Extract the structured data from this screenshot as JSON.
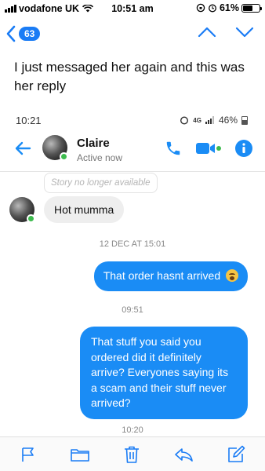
{
  "status_bar": {
    "carrier": "vodafone UK",
    "time": "10:51 am",
    "battery": "61%",
    "battery_level": 0.61
  },
  "mail_nav": {
    "unread_count": "63",
    "icons": [
      "back-chevron-icon",
      "up-chevron-icon",
      "down-chevron-icon"
    ]
  },
  "post_text": "I just messaged her again and this was her reply",
  "screenshot": {
    "status": {
      "time": "10:21",
      "network": "4G",
      "battery": "46%"
    },
    "header": {
      "name": "Claire",
      "subtitle": "Active now"
    },
    "story_notice": "Story no longer available",
    "messages": [
      {
        "direction": "in",
        "text": "Hot mumma"
      },
      {
        "timestamp": "12 DEC AT 15:01"
      },
      {
        "direction": "out",
        "text": "That order hasnt arrived",
        "emoji": "fearful-face"
      },
      {
        "timestamp": "09:51"
      },
      {
        "direction": "out",
        "text": "That stuff you said you ordered did it definitely arrive? Everyones saying its a scam and their stuff never arrived?"
      },
      {
        "timestamp": "10:20"
      }
    ]
  },
  "toolbar": {
    "icons": [
      "flag-icon",
      "folder-icon",
      "trash-icon",
      "reply-icon",
      "compose-icon"
    ]
  },
  "colors": {
    "ios_blue": "#1a7cf5",
    "messenger_blue": "#1a8cf5",
    "online_green": "#3dbb4e",
    "incoming_bubble": "#eeeeee"
  }
}
